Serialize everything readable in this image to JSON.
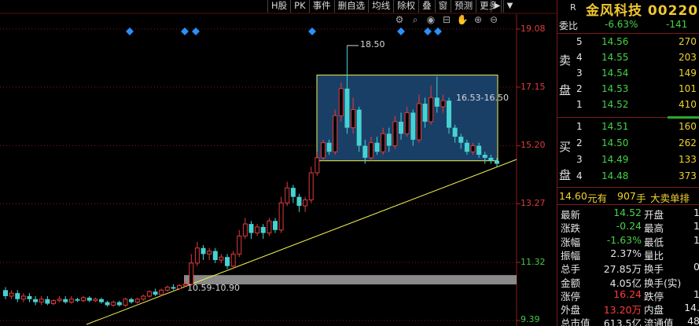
{
  "toolbar": {
    "buttons": [
      "H股",
      "PK",
      "事件",
      "删自选",
      "均线",
      "除权",
      "叠",
      "窗",
      "预测",
      "更多"
    ]
  },
  "toolbar_icons": [
    "gear-icon",
    "zoom-icon",
    "eye-icon",
    "delete-icon",
    "hand-icon",
    "zoom-in-icon",
    "zoom-out-icon"
  ],
  "colors": {
    "up": "#e03c3c",
    "down": "#46d2d2",
    "box_fill": "#1a3f66",
    "box_border": "#f0f050",
    "trendline": "#f0f050",
    "gap_band": "#8a8a8a"
  },
  "chart_data": {
    "type": "candlestick",
    "y_axis_ticks": [
      "19.08",
      "17.15",
      "15.20",
      "13.27",
      "11.32",
      "9.39"
    ],
    "ylim": [
      9.39,
      19.08
    ],
    "annotations": {
      "high_marker": "18.50",
      "box_range": "16.53-16.50",
      "gap_range": "10.59-10.90"
    },
    "candles": [
      [
        10.4,
        10.2,
        10.5,
        10.1
      ],
      [
        10.2,
        10.3,
        10.4,
        10.1
      ],
      [
        10.3,
        10.1,
        10.4,
        10.0
      ],
      [
        10.1,
        10.2,
        10.3,
        10.0
      ],
      [
        10.2,
        10.1,
        10.3,
        10.0
      ],
      [
        10.1,
        10.0,
        10.2,
        9.9
      ],
      [
        10.0,
        10.1,
        10.2,
        9.9
      ],
      [
        10.1,
        9.95,
        10.2,
        9.9
      ],
      [
        9.95,
        10.05,
        10.1,
        9.9
      ],
      [
        10.05,
        10.1,
        10.2,
        10.0
      ],
      [
        10.1,
        10.0,
        10.2,
        9.95
      ],
      [
        10.0,
        10.1,
        10.2,
        9.95
      ],
      [
        10.1,
        10.05,
        10.15,
        10.0
      ],
      [
        10.05,
        10.15,
        10.2,
        10.0
      ],
      [
        10.15,
        10.05,
        10.2,
        10.0
      ],
      [
        10.05,
        10.1,
        10.15,
        10.0
      ],
      [
        10.1,
        10.0,
        10.15,
        9.95
      ],
      [
        10.0,
        9.9,
        10.05,
        9.85
      ],
      [
        9.9,
        10.0,
        10.05,
        9.85
      ],
      [
        10.0,
        9.9,
        10.05,
        9.85
      ],
      [
        9.9,
        10.1,
        10.15,
        9.85
      ],
      [
        10.1,
        10.0,
        10.15,
        9.95
      ],
      [
        10.0,
        10.1,
        10.15,
        9.95
      ],
      [
        10.1,
        10.2,
        10.25,
        10.05
      ],
      [
        10.2,
        10.35,
        10.4,
        10.15
      ],
      [
        10.35,
        10.25,
        10.45,
        10.2
      ],
      [
        10.25,
        10.4,
        10.45,
        10.2
      ],
      [
        10.4,
        10.5,
        10.55,
        10.35
      ],
      [
        10.5,
        10.45,
        10.6,
        10.4
      ],
      [
        10.45,
        10.55,
        10.6,
        10.4
      ],
      [
        10.55,
        10.6,
        10.7,
        10.5
      ],
      [
        10.6,
        11.3,
        11.6,
        10.55
      ],
      [
        11.3,
        11.8,
        12.0,
        11.2
      ],
      [
        11.8,
        11.6,
        11.9,
        11.4
      ],
      [
        11.6,
        11.7,
        11.8,
        11.4
      ],
      [
        11.7,
        11.4,
        11.8,
        11.3
      ],
      [
        11.4,
        11.5,
        11.6,
        11.3
      ],
      [
        11.5,
        11.2,
        11.6,
        11.1
      ],
      [
        11.2,
        11.6,
        11.7,
        11.1
      ],
      [
        11.6,
        12.2,
        12.4,
        11.5
      ],
      [
        12.2,
        12.6,
        12.8,
        12.1
      ],
      [
        12.6,
        12.3,
        12.7,
        12.1
      ],
      [
        12.3,
        12.5,
        12.6,
        12.2
      ],
      [
        12.5,
        12.3,
        12.6,
        12.1
      ],
      [
        12.3,
        12.7,
        12.8,
        12.2
      ],
      [
        12.7,
        12.4,
        12.8,
        12.3
      ],
      [
        12.4,
        13.3,
        13.5,
        12.3
      ],
      [
        13.3,
        13.8,
        14.0,
        13.2
      ],
      [
        13.8,
        13.5,
        13.9,
        13.3
      ],
      [
        13.5,
        13.2,
        13.6,
        13.0
      ],
      [
        13.2,
        13.4,
        13.5,
        13.0
      ],
      [
        13.4,
        14.3,
        14.5,
        13.3
      ],
      [
        14.3,
        14.8,
        15.0,
        14.2
      ],
      [
        14.8,
        15.3,
        15.4,
        14.7
      ],
      [
        15.3,
        15.0,
        15.4,
        14.9
      ],
      [
        15.0,
        16.2,
        16.4,
        14.9
      ],
      [
        16.2,
        17.1,
        17.3,
        16.0
      ],
      [
        17.1,
        15.8,
        18.5,
        15.6
      ],
      [
        15.8,
        16.4,
        16.8,
        15.6
      ],
      [
        16.4,
        15.2,
        16.5,
        15.0
      ],
      [
        15.2,
        14.8,
        15.4,
        14.6
      ],
      [
        14.8,
        15.3,
        15.5,
        14.7
      ],
      [
        15.3,
        15.0,
        15.5,
        14.9
      ],
      [
        15.0,
        15.6,
        15.8,
        14.9
      ],
      [
        15.6,
        15.2,
        15.8,
        15.0
      ],
      [
        15.2,
        16.0,
        16.2,
        15.1
      ],
      [
        16.0,
        15.6,
        16.3,
        15.4
      ],
      [
        15.6,
        16.3,
        16.5,
        15.5
      ],
      [
        16.3,
        15.4,
        16.4,
        15.2
      ],
      [
        15.4,
        16.6,
        16.9,
        15.3
      ],
      [
        16.6,
        16.0,
        16.8,
        15.8
      ],
      [
        16.0,
        16.8,
        17.2,
        15.9
      ],
      [
        16.8,
        16.5,
        17.5,
        16.3
      ],
      [
        16.5,
        16.7,
        16.9,
        16.3
      ],
      [
        16.7,
        15.8,
        16.8,
        15.6
      ],
      [
        15.8,
        15.5,
        15.9,
        15.3
      ],
      [
        15.5,
        15.3,
        15.6,
        15.1
      ],
      [
        15.3,
        15.0,
        15.4,
        14.9
      ],
      [
        15.0,
        15.2,
        15.3,
        14.9
      ],
      [
        15.2,
        14.9,
        15.3,
        14.8
      ],
      [
        14.9,
        14.8,
        15.0,
        14.6
      ],
      [
        14.8,
        14.7,
        14.9,
        14.6
      ],
      [
        14.7,
        14.6,
        14.8,
        14.5
      ]
    ]
  },
  "panel": {
    "title_r": "R",
    "title": "金风科技 00220",
    "webi": {
      "label": "委比",
      "pct": "-6.63%",
      "diff": "-141"
    },
    "sell_label_top": "卖",
    "sell_label_bottom": "盘",
    "buy_label_top": "买",
    "buy_label_bottom": "盘",
    "asks": [
      {
        "level": "5",
        "price": "14.56",
        "vol": "270"
      },
      {
        "level": "4",
        "price": "14.55",
        "vol": "203"
      },
      {
        "level": "3",
        "price": "14.54",
        "vol": "149"
      },
      {
        "level": "2",
        "price": "14.53",
        "vol": "101"
      },
      {
        "level": "1",
        "price": "14.52",
        "vol": "410"
      }
    ],
    "bids": [
      {
        "level": "1",
        "price": "14.51",
        "vol": "160"
      },
      {
        "level": "2",
        "price": "14.50",
        "vol": "262"
      },
      {
        "level": "3",
        "price": "14.49",
        "vol": "133"
      },
      {
        "level": "4",
        "price": "14.48",
        "vol": "373"
      }
    ],
    "big_order": {
      "price": "14.60",
      "unit": "元有",
      "vol": "907",
      "unit2": "手",
      "text": "大卖单排"
    },
    "stats": [
      {
        "l": "最新",
        "v": "14.52",
        "vc": "green",
        "l2": "开盘",
        "v2": "1"
      },
      {
        "l": "涨跌",
        "v": "-0.24",
        "vc": "green",
        "l2": "最高",
        "v2": "1"
      },
      {
        "l": "涨幅",
        "v": "-1.63%",
        "vc": "green",
        "l2": "最低",
        "v2": "1"
      },
      {
        "l": "振幅",
        "v": "2.37%",
        "vc": "white",
        "l2": "量比",
        "v2": ""
      },
      {
        "l": "总手",
        "v": "27.85万",
        "vc": "white",
        "l2": "换手",
        "v2": "0"
      },
      {
        "l": "金额",
        "v": "4.05亿",
        "vc": "white",
        "l2": "换手(实)",
        "v2": ""
      },
      {
        "l": "涨停",
        "v": "16.24",
        "vc": "red",
        "l2": "跌停",
        "v2": "1"
      },
      {
        "l": "外盘",
        "v": "13.20万",
        "vc": "red",
        "l2": "内盘",
        "v2": "14."
      },
      {
        "l": "总市值",
        "v": "613.5亿",
        "vc": "white",
        "l2": "流通值",
        "v2": "48"
      }
    ]
  }
}
